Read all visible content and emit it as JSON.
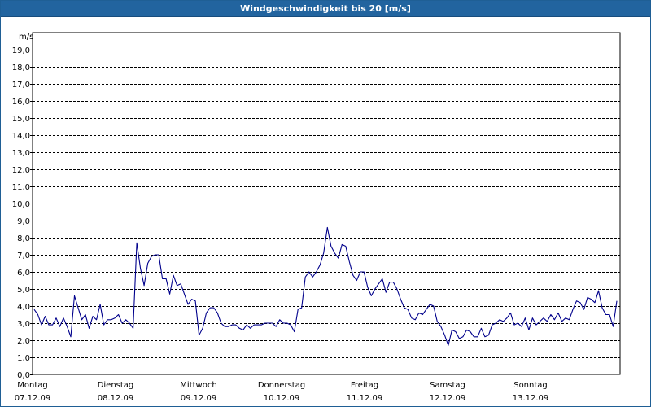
{
  "window": {
    "title": "Windgeschwindigkeit bis 20 [m/s]"
  },
  "colors": {
    "titlebar": "#22649f",
    "series_line": "#00008b",
    "grid": "#000000"
  },
  "chart_data": {
    "type": "line",
    "title": "Windgeschwindigkeit bis 20 [m/s]",
    "ylabel": "m/s",
    "ylim": [
      0,
      20
    ],
    "y_ticks": [
      "0,0",
      "1,0",
      "2,0",
      "3,0",
      "4,0",
      "5,0",
      "6,0",
      "7,0",
      "8,0",
      "9,0",
      "10,0",
      "11,0",
      "12,0",
      "13,0",
      "14,0",
      "15,0",
      "16,0",
      "17,0",
      "18,0",
      "19,0"
    ],
    "grid": true,
    "days": [
      {
        "name": "Montag",
        "date": "07.12.09"
      },
      {
        "name": "Dienstag",
        "date": "08.12.09"
      },
      {
        "name": "Mittwoch",
        "date": "09.12.09"
      },
      {
        "name": "Donnerstag",
        "date": "10.12.09"
      },
      {
        "name": "Freitag",
        "date": "11.12.09"
      },
      {
        "name": "Samstag",
        "date": "12.12.09"
      },
      {
        "name": "Sonntag",
        "date": "13.12.09"
      }
    ],
    "series": [
      {
        "values": [
          3.8,
          3.5,
          2.9,
          3.4,
          2.9,
          2.9,
          3.3,
          2.8,
          3.3,
          2.8,
          2.2,
          4.6,
          3.9,
          3.2,
          3.5,
          2.7,
          3.4,
          3.2,
          4.1,
          2.9,
          3.2,
          3.2,
          3.3,
          3.5,
          3.0,
          3.2,
          3.0,
          2.7,
          7.7,
          6.2,
          5.2,
          6.5,
          6.9,
          7.0,
          7.0,
          5.6,
          5.6,
          4.7,
          5.8,
          5.2,
          5.3,
          4.7,
          4.1,
          4.4,
          4.3,
          2.3,
          2.7,
          3.6,
          3.9,
          3.9,
          3.6,
          3.0,
          2.8,
          2.8,
          2.9,
          2.9,
          2.7,
          2.6,
          2.9,
          2.7,
          2.9,
          2.9,
          2.9,
          3.0,
          3.0,
          3.0,
          2.8,
          3.2,
          3.0,
          3.0,
          2.9,
          2.5,
          3.8,
          3.9,
          5.7,
          6.0,
          5.7,
          6.0,
          6.4,
          7.1,
          8.6,
          7.5,
          7.1,
          6.8,
          7.6,
          7.5,
          6.6,
          5.8,
          5.5,
          6.0,
          6.0,
          5.1,
          4.6,
          5.0,
          5.3,
          5.6,
          4.8,
          5.4,
          5.4,
          5.0,
          4.4,
          3.9,
          3.8,
          3.3,
          3.2,
          3.6,
          3.5,
          3.8,
          4.1,
          4.0,
          3.1,
          2.8,
          2.3,
          1.7,
          2.6,
          2.5,
          2.1,
          2.2,
          2.6,
          2.5,
          2.2,
          2.2,
          2.7,
          2.2,
          2.3,
          2.9,
          3.0,
          3.2,
          3.1,
          3.3,
          3.6,
          2.9,
          3.0,
          2.8,
          3.3,
          2.6,
          3.3,
          2.9,
          3.1,
          3.3,
          3.1,
          3.5,
          3.2,
          3.6,
          3.1,
          3.3,
          3.2,
          3.8,
          4.3,
          4.2,
          3.8,
          4.5,
          4.4,
          4.2,
          4.9,
          3.9,
          3.5,
          3.5,
          2.8,
          4.3
        ]
      }
    ]
  }
}
